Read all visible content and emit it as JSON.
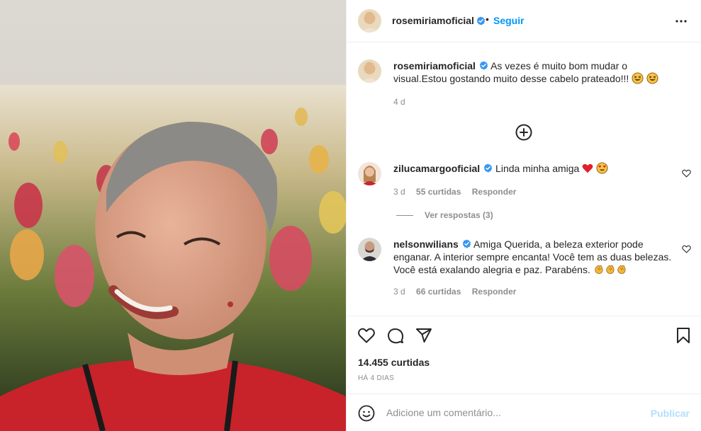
{
  "post": {
    "author": "rosemiriamoficial",
    "follow_label": "Seguir",
    "separator": "•",
    "caption": "As vezes é muito bom mudar o visual.Estou gostando muito desse cabelo prateado!!!",
    "caption_age": "4 d"
  },
  "comments": [
    {
      "username": "zilucamargooficial",
      "text": "Linda minha amiga",
      "emojis": [
        "red-heart",
        "heart-eyes"
      ],
      "age": "3 d",
      "likes": "55 curtidas",
      "reply_label": "Responder",
      "view_replies": "Ver respostas (3)"
    },
    {
      "username": "nelsonwilians",
      "text": "Amiga Querida, a beleza exterior pode enganar. A interior sempre encanta! Você tem as duas belezas. Você está exalando alegria e paz. Parabéns.",
      "emojis": [
        "clapping-hands",
        "clapping-hands",
        "clapping-hands"
      ],
      "age": "3 d",
      "likes": "66 curtidas",
      "reply_label": "Responder"
    }
  ],
  "stats": {
    "likes": "14.455 curtidas",
    "posted": "HÁ 4 DIAS"
  },
  "comment_box": {
    "placeholder": "Adicione um comentário...",
    "publish_label": "Publicar"
  },
  "colors": {
    "accent": "#0095f6",
    "verified": "#3897f0",
    "muted": "#8e8e8e",
    "publish_disabled": "#b2dffc"
  }
}
